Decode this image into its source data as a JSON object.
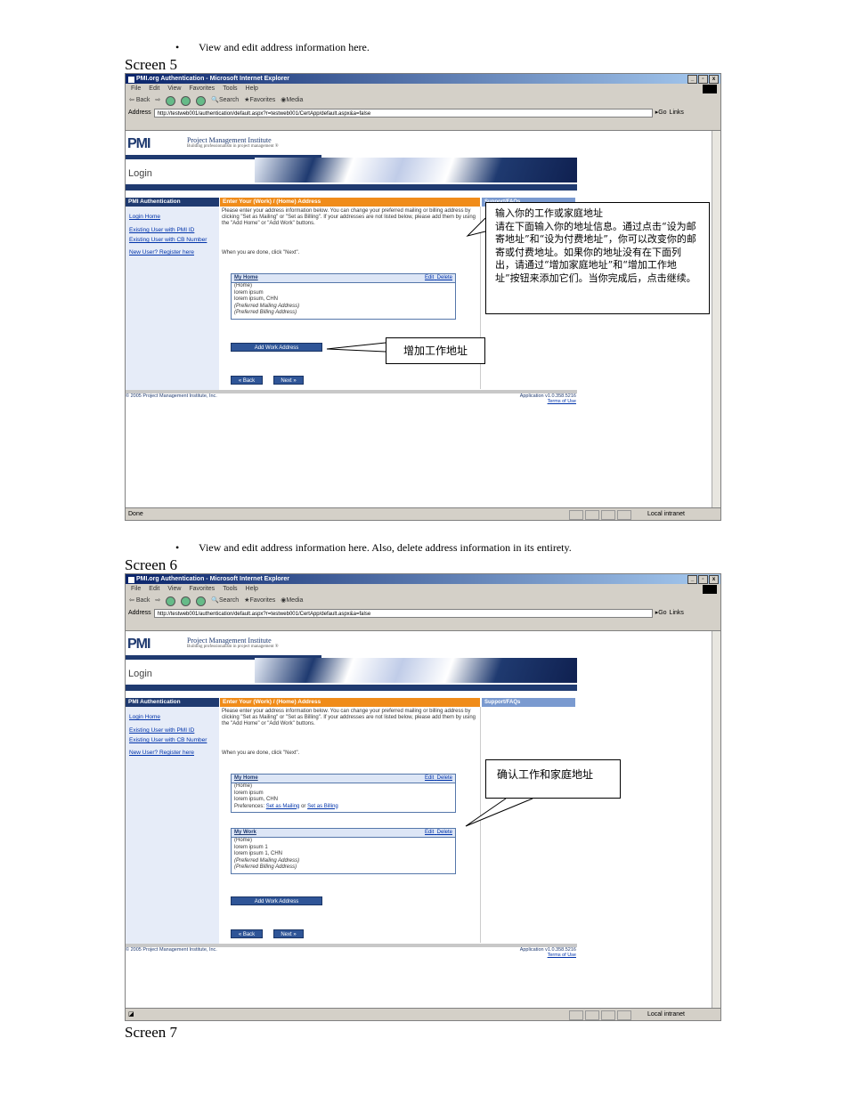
{
  "bullets": {
    "screen5": "View and edit address information here.",
    "screen6": "View and edit address information here.  Also, delete address information in its entirety."
  },
  "captions": {
    "screen5": "Screen 5",
    "screen6": "Screen 6",
    "screen7": "Screen 7"
  },
  "browser": {
    "title": "PMI.org Authentication - Microsoft Internet Explorer",
    "menu": [
      "File",
      "Edit",
      "View",
      "Favorites",
      "Tools",
      "Help"
    ],
    "toolbar": [
      "Back",
      "Search",
      "Favorites",
      "Media"
    ],
    "address_label": "Address",
    "url": "http://testweb001/authentication/default.aspx?r=testweb001/CertApp/default.aspx&a=false",
    "go_label": "Go",
    "links_label": "Links",
    "status_done": "Done",
    "status_zone": "Local intranet"
  },
  "page": {
    "org_name": "Project Management Institute",
    "tagline": "Building professionalism in project management ®",
    "logo": "PMI",
    "login_label": "Login",
    "nav_header": "PMI Authentication",
    "nav_links": [
      "Login Home",
      "Existing User with PMI ID",
      "Existing User with CB Number",
      "New User? Register here"
    ],
    "main_header": "Enter Your (Work) / (Home) Address",
    "support_header": "Support/FAQs",
    "instructions": "Please enter your address information below. You can change your preferred mailing or billing address by clicking \"Set as Mailing\" or \"Set as Billing\". If your addresses are not listed below, please add them by using the \"Add Home\" or \"Add Work\" buttons.",
    "when_done": "When you are done, click \"Next\".",
    "edit": "Edit",
    "delete": "Delete",
    "add_work": "Add Work Address",
    "back": "« Back",
    "next": "Next »",
    "copyright": "© 2005 Project Management Institute, Inc.",
    "app_version": "Application v1.0.358.5216",
    "terms": "Terms of Use"
  },
  "screen5": {
    "home_card": {
      "title": "My Home",
      "lines": [
        "(Home)",
        "lorem ipsum",
        "lorem ipsum, CHN"
      ],
      "pref_mailing": "(Preferred Mailing Address)",
      "pref_billing": "(Preferred Billing Address)"
    },
    "callout_main": "输入你的工作或家庭地址\n请在下面输入你的地址信息。通过点击“设为邮寄地址”和“设为付费地址”，你可以改变你的邮寄或付费地址。如果你的地址没有在下面列出，请通过“增加家庭地址”和“增加工作地址”按钮来添加它们。当你完成后，点击继续。",
    "callout_add": "增加工作地址"
  },
  "screen6": {
    "home_card": {
      "title": "My Home",
      "lines": [
        "(Home)",
        "lorem ipsum",
        "lorem ipsum, CHN"
      ],
      "pref_prefix": "Preferences:",
      "set_mailing": "Set as Mailing",
      "or": "or",
      "set_billing": "Set as Billing"
    },
    "work_card": {
      "title": "My Work",
      "lines": [
        "(Home)",
        "lorem ipsum 1",
        "lorem ipsum 1, CHN"
      ],
      "pref_mailing": "(Preferred Mailing Address)",
      "pref_billing": "(Preferred Billing Address)"
    },
    "callout": "确认工作和家庭地址"
  }
}
